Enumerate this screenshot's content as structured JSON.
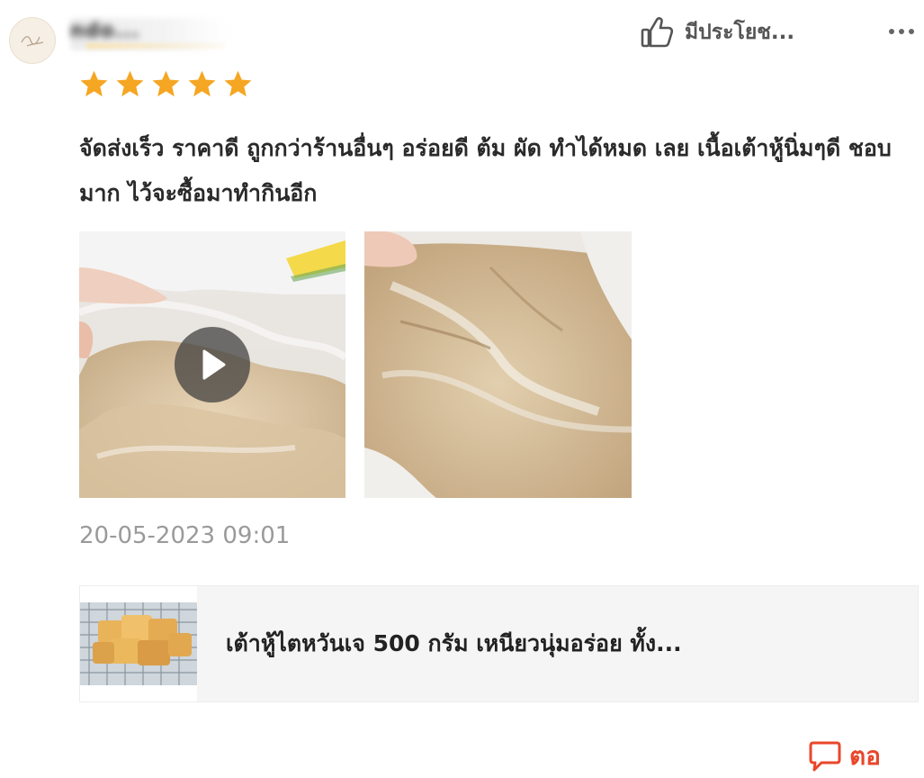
{
  "review": {
    "username": "ndo...",
    "rating": 5,
    "helpful_label": "มีประโยช...",
    "text": "จัดส่งเร็ว ราคาดี ถูกกว่าร้านอื่นๆ อร่อยดี ต้ม ผัด ทำได้หมด เลย เนื้อเต้าหู้นิ่มๆดี ชอบมาก ไว้จะซื้อมาทำกินอีก",
    "timestamp": "20-05-2023 09:01"
  },
  "product": {
    "title": "เต้าหู้ไตหวันเจ 500 กรัม เหนียวนุ่มอร่อย ทั้ง..."
  },
  "actions": {
    "reply_label": "ตอ"
  },
  "colors": {
    "star": "#f5a623",
    "accent": "#e8472b",
    "timestamp": "#9a9a9a",
    "card_bg": "#f5f5f5"
  },
  "icons": {
    "helpful": "thumbs-up-icon",
    "more": "more-dots-icon",
    "play": "play-icon",
    "reply": "chat-bubble-icon"
  }
}
